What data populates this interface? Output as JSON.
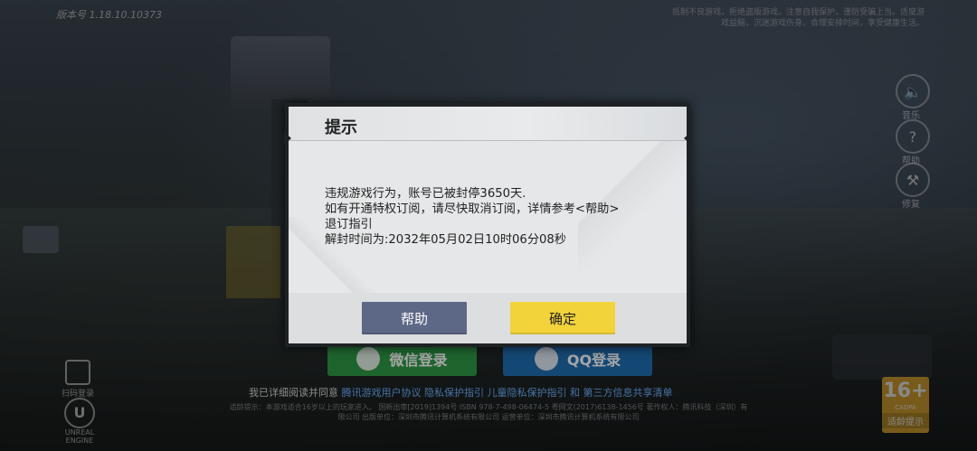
{
  "background": {
    "version": "版本号 1.18.10.10373",
    "health_tip": "抵制不良游戏，拒绝盗版游戏。注意自我保护，谨防受骗上当。适度游戏益脑，沉迷游戏伤身。合理安排时间，享受健康生活。",
    "side_buttons": [
      {
        "icon": "speaker-icon",
        "label": "音乐"
      },
      {
        "icon": "question-icon",
        "label": "帮助"
      },
      {
        "icon": "wrench-icon",
        "label": "修复"
      }
    ],
    "wechat_login": "微信登录",
    "qq_login": "QQ登录",
    "agreement_prefix": "我已详细阅读并同意",
    "agreement_links": "腾讯游戏用户协议 隐私保护指引 儿童隐私保护指引 和 第三方信息共享清单",
    "footer_text": "适龄提示：本游戏适合16岁以上的玩家进入。 国新出审[2019]1394号 ISBN 978-7-498-06474-5 粤网文(2017)6138-1456号 著作权人：腾讯科技（深圳）有限公司 出版单位：深圳市腾讯计算机系统有限公司 运营单位：深圳市腾讯计算机系统有限公司",
    "qr_label": "扫码登录",
    "unreal_text": "UNREAL ENGINE",
    "age_badge": {
      "number": "16+",
      "sub": "CADPA",
      "tip": "适龄提示"
    }
  },
  "dialog": {
    "title": "提示",
    "lines": [
      "违规游戏行为，账号已被封停3650天.",
      "如有开通特权订阅，请尽快取消订阅，详情参考<帮助>",
      "退订指引",
      "解封时间为:2032年05月02日10时06分08秒"
    ],
    "help_button": "帮助",
    "confirm_button": "确定"
  },
  "colors": {
    "help_button": "#5d6786",
    "confirm_button": "#f2d33a",
    "wechat": "#2f9a45",
    "qq": "#1f6fb2"
  }
}
